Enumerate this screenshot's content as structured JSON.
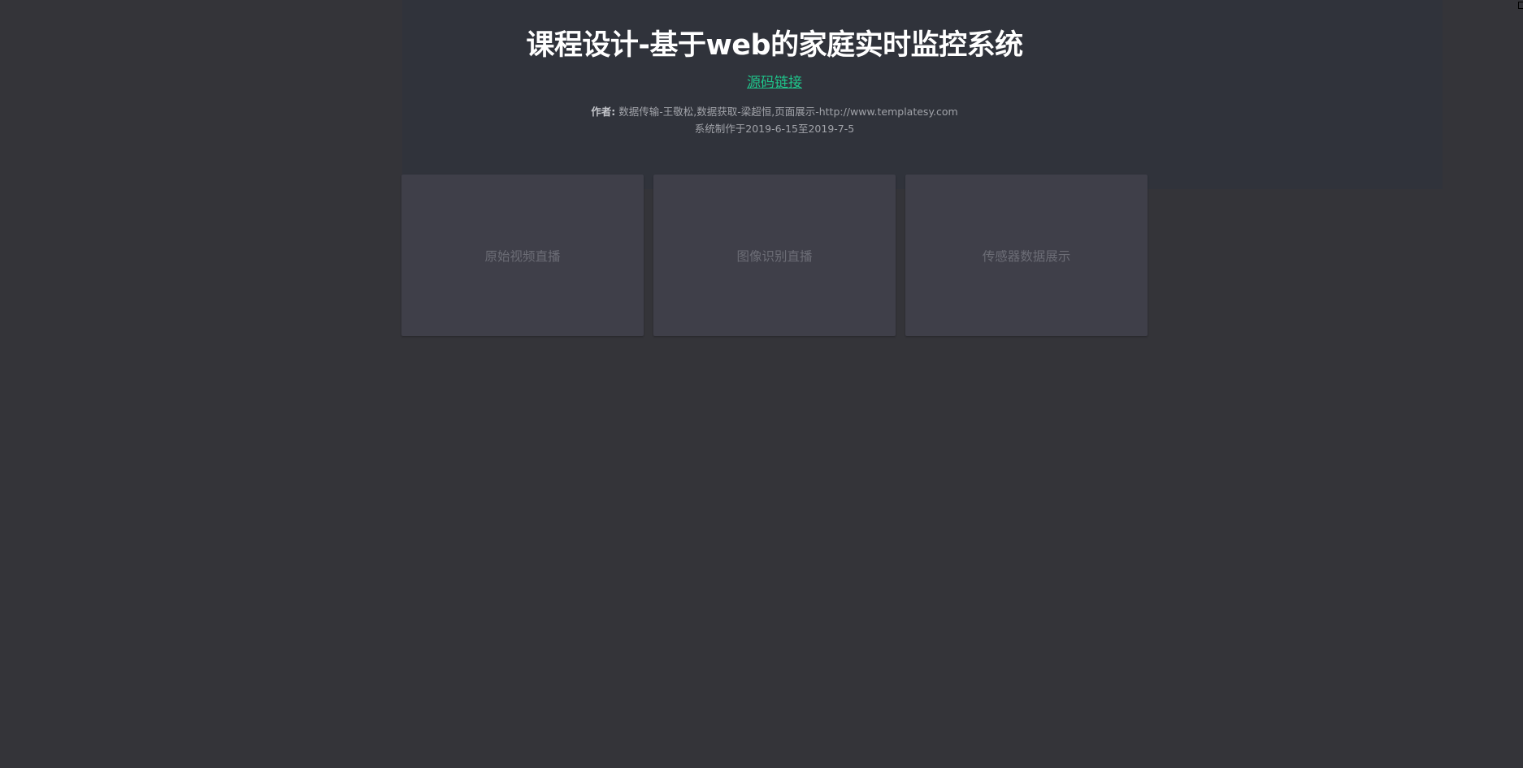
{
  "header": {
    "title": "课程设计-基于web的家庭实时监控系统",
    "source_link": "源码链接",
    "authors_label": "作者:",
    "authors_text": " 数据传输-王敬松,数据获取-梁超恒,页面展示-http://www.templatesy.com",
    "dates": "系统制作于2019-6-15至2019-7-5"
  },
  "tiles": [
    {
      "label": "原始视频直播"
    },
    {
      "label": "图像识别直播"
    },
    {
      "label": "传感器数据展示"
    }
  ],
  "colors": {
    "background": "#343439",
    "header_panel": "#30333b",
    "tile": "#3f3f49",
    "link": "#1fc58b",
    "title": "#ffffff"
  }
}
